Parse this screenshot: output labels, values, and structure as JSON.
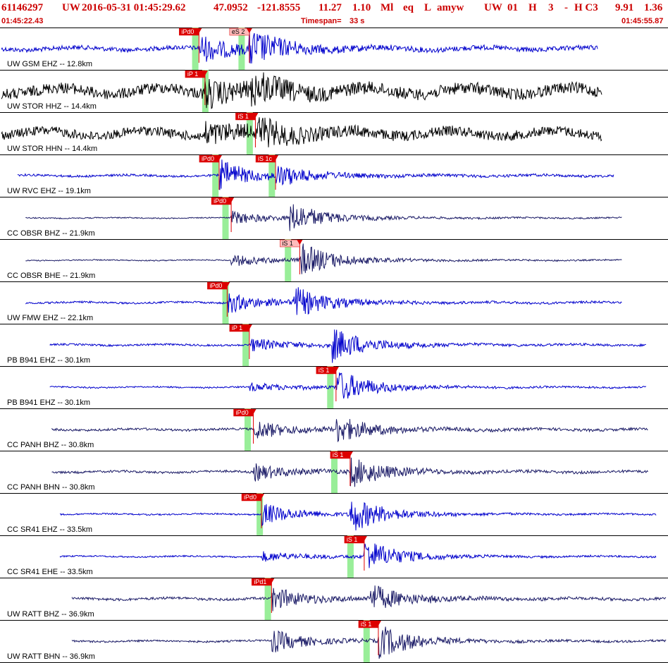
{
  "header": {
    "event_id": "61146297",
    "network": "UW",
    "datetime": "2016-05-31 01:45:29.62",
    "lat": "47.0952",
    "lon": "-121.8555",
    "depth": "11.27",
    "magnitude": "1.10",
    "mag_type": "Ml",
    "event_type": "eq",
    "flag": "L",
    "author": "amyw",
    "origin_net": "UW",
    "version": "01",
    "h1": "H",
    "num": "3",
    "dash": "-",
    "h2": "H C3",
    "v1": "9.91",
    "v2": "1.36"
  },
  "time_row": {
    "start": "01:45:22.43",
    "timespan_label": "Timespan=",
    "timespan_value": "33 s",
    "end": "01:45:55.87"
  },
  "colors": {
    "header_red": "#cc0000",
    "blue_trace": "#0000cc",
    "black_trace": "#000000",
    "navy_trace": "#1a1a66",
    "pick_band": "#99ee99",
    "pick_label": "#dd0000",
    "pick_label_light": "#ffbbbb",
    "separator": "#000000"
  },
  "chart_data": {
    "type": "seismogram",
    "x_range_seconds": [
      0,
      33
    ],
    "traces": [
      {
        "label": "UW GSM EHZ -- 12.8km",
        "color": "blue",
        "picks": [
          {
            "label": "iPd0",
            "t": 9.8,
            "style": "solid",
            "band_t": 9.6
          },
          {
            "label": "eS 2",
            "t": 12.3,
            "style": "light",
            "band_t": 11.9
          }
        ],
        "p_time": 9.8,
        "s_time": 12.3,
        "trace_start": 0.0,
        "trace_end": 29.6,
        "noise": 0.12,
        "p_amp": 0.7,
        "s_amp": 0.9
      },
      {
        "label": "UW STOR HHZ -- 14.4km",
        "color": "black",
        "picks": [
          {
            "label": "iP 1",
            "t": 10.1,
            "style": "solid",
            "band_t": 10.1
          }
        ],
        "p_time": 10.1,
        "s_time": 12.4,
        "trace_start": 0.0,
        "trace_end": 29.8,
        "noise": 0.3,
        "p_amp": 0.6,
        "s_amp": 0.7
      },
      {
        "label": "UW STOR HHN -- 14.4km",
        "color": "black",
        "picks": [
          {
            "label": "iS 1",
            "t": 12.6,
            "style": "solid",
            "band_t": 12.3
          }
        ],
        "p_time": 10.1,
        "s_time": 12.6,
        "trace_start": 0.0,
        "trace_end": 29.8,
        "noise": 0.25,
        "p_amp": 0.5,
        "s_amp": 0.7
      },
      {
        "label": "UW RVC EHZ -- 19.1km",
        "color": "blue",
        "picks": [
          {
            "label": "iPd0",
            "t": 10.8,
            "style": "solid",
            "band_t": 10.6
          },
          {
            "label": "iS 1c",
            "t": 13.6,
            "style": "solid",
            "band_t": 13.4
          }
        ],
        "p_time": 10.8,
        "s_time": 13.6,
        "trace_start": 0.8,
        "trace_end": 30.4,
        "noise": 0.06,
        "p_amp": 0.8,
        "s_amp": 0.5
      },
      {
        "label": "CC OBSR BHZ -- 21.9km",
        "color": "navy",
        "picks": [
          {
            "label": "iPd0",
            "t": 11.4,
            "style": "solid",
            "band_t": 11.1
          }
        ],
        "p_time": 11.4,
        "s_time": 14.3,
        "trace_start": 1.2,
        "trace_end": 30.8,
        "noise": 0.03,
        "p_amp": 0.3,
        "s_amp": 0.8
      },
      {
        "label": "CC OBSR BHE -- 21.9km",
        "color": "navy",
        "picks": [
          {
            "label": "iS 1",
            "t": 14.8,
            "style": "light",
            "band_t": 14.2
          }
        ],
        "p_time": 11.4,
        "s_time": 14.8,
        "trace_start": 1.2,
        "trace_end": 30.8,
        "noise": 0.03,
        "p_amp": 0.25,
        "s_amp": 0.9
      },
      {
        "label": "UW FMW EHZ -- 22.1km",
        "color": "blue",
        "picks": [
          {
            "label": "iPd0",
            "t": 11.2,
            "style": "solid",
            "band_t": 11.1
          }
        ],
        "p_time": 11.2,
        "s_time": 14.5,
        "trace_start": 1.2,
        "trace_end": 30.8,
        "noise": 0.05,
        "p_amp": 0.5,
        "s_amp": 0.8
      },
      {
        "label": "PB B941 EHZ -- 30.1km",
        "color": "blue",
        "picks": [
          {
            "label": "iP 1",
            "t": 12.3,
            "style": "solid",
            "band_t": 12.1
          }
        ],
        "p_time": 12.3,
        "s_time": 16.4,
        "trace_start": 2.4,
        "trace_end": 32.0,
        "noise": 0.05,
        "p_amp": 0.3,
        "s_amp": 0.9
      },
      {
        "label": "PB B941 EHZ -- 30.1km",
        "color": "blue",
        "picks": [
          {
            "label": "iS 1",
            "t": 16.6,
            "style": "solid",
            "band_t": 16.3
          }
        ],
        "p_time": 12.3,
        "s_time": 16.6,
        "trace_start": 2.4,
        "trace_end": 32.0,
        "noise": 0.04,
        "p_amp": 0.15,
        "s_amp": 0.9
      },
      {
        "label": "CC PANH BHZ -- 30.8km",
        "color": "navy",
        "picks": [
          {
            "label": "iPd0",
            "t": 12.5,
            "style": "solid",
            "band_t": 12.2
          }
        ],
        "p_time": 12.5,
        "s_time": 16.6,
        "trace_start": 2.5,
        "trace_end": 32.1,
        "noise": 0.06,
        "p_amp": 0.5,
        "s_amp": 0.7
      },
      {
        "label": "CC PANH BHN -- 30.8km",
        "color": "navy",
        "picks": [
          {
            "label": "iS 1",
            "t": 17.3,
            "style": "solid",
            "band_t": 16.5
          }
        ],
        "p_time": 12.5,
        "s_time": 17.3,
        "trace_start": 2.5,
        "trace_end": 32.1,
        "noise": 0.06,
        "p_amp": 0.4,
        "s_amp": 0.8
      },
      {
        "label": "CC SR41 EHZ -- 33.5km",
        "color": "blue",
        "picks": [
          {
            "label": "iPd0",
            "t": 12.9,
            "style": "solid",
            "band_t": 12.8
          }
        ],
        "p_time": 12.9,
        "s_time": 17.3,
        "trace_start": 2.9,
        "trace_end": 32.5,
        "noise": 0.04,
        "p_amp": 0.6,
        "s_amp": 0.95
      },
      {
        "label": "CC SR41 EHE -- 33.5km",
        "color": "blue",
        "picks": [
          {
            "label": "iS 1",
            "t": 18.0,
            "style": "solid",
            "band_t": 17.3
          }
        ],
        "p_time": 12.9,
        "s_time": 18.0,
        "trace_start": 2.9,
        "trace_end": 32.5,
        "noise": 0.04,
        "p_amp": 0.2,
        "s_amp": 0.9
      },
      {
        "label": "UW RATT BHZ -- 36.9km",
        "color": "navy",
        "picks": [
          {
            "label": "iPd1",
            "t": 13.4,
            "style": "solid",
            "band_t": 13.2
          }
        ],
        "p_time": 13.4,
        "s_time": 18.3,
        "trace_start": 3.5,
        "trace_end": 33.0,
        "noise": 0.07,
        "p_amp": 0.6,
        "s_amp": 0.7
      },
      {
        "label": "UW RATT BHN -- 36.9km",
        "color": "navy",
        "picks": [
          {
            "label": "iS 1",
            "t": 18.7,
            "style": "solid",
            "band_t": 18.1
          }
        ],
        "p_time": 13.4,
        "s_time": 18.7,
        "trace_start": 3.5,
        "trace_end": 33.0,
        "noise": 0.05,
        "p_amp": 0.6,
        "s_amp": 0.9
      }
    ]
  }
}
